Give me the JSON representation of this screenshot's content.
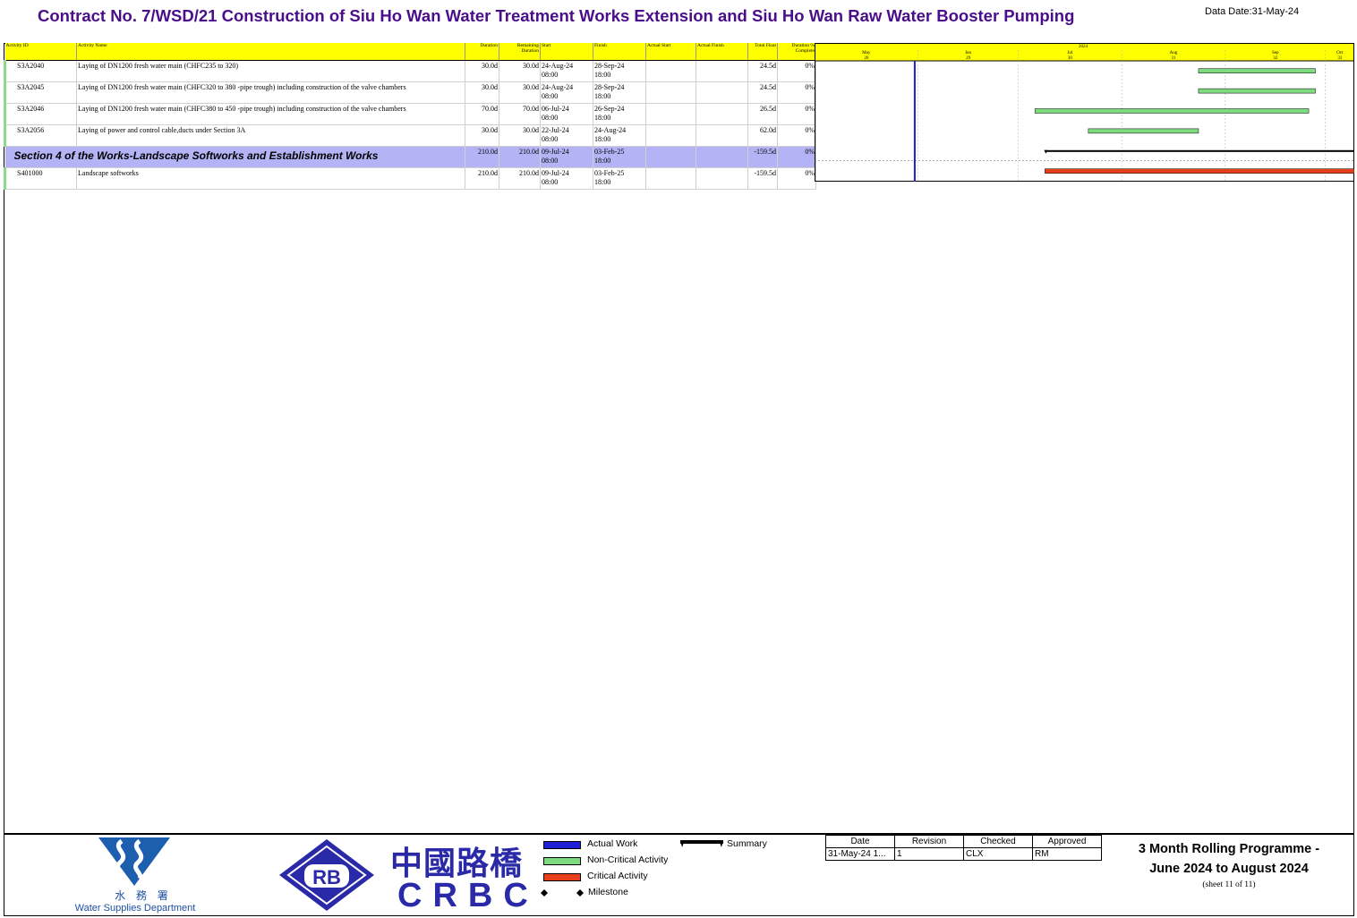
{
  "header": {
    "title": "Contract No. 7/WSD/21 Construction of Siu Ho Wan Water Treatment Works Extension and Siu Ho Wan Raw Water Booster Pumping",
    "data_date": "Data Date:31-May-24"
  },
  "columns": [
    "Activity ID",
    "Activity Name",
    "Duration",
    "Remaining Duration",
    "Start",
    "Finish",
    "Actual Start",
    "Actual Finish",
    "Total Float",
    "Duration % Complete"
  ],
  "rows": [
    {
      "type": "activity",
      "id": "S3A2040",
      "name": "Laying of DN1200 fresh water main (CHFC235 to 320)",
      "duration": "30.0d",
      "remaining": "30.0d",
      "start": "24-Aug-24",
      "start_time": "08:00",
      "finish": "28-Sep-24",
      "finish_time": "18:00",
      "actual_start": "",
      "actual_finish": "",
      "float": "24.5d",
      "complete": "0%"
    },
    {
      "type": "activity",
      "id": "S3A2045",
      "name": "Laying of DN1200 fresh water main (CHFC320 to 380 -pipe trough) including construction of the valve chambers",
      "duration": "30.0d",
      "remaining": "30.0d",
      "start": "24-Aug-24",
      "start_time": "08:00",
      "finish": "28-Sep-24",
      "finish_time": "18:00",
      "actual_start": "",
      "actual_finish": "",
      "float": "24.5d",
      "complete": "0%"
    },
    {
      "type": "activity",
      "id": "S3A2046",
      "name": "Laying of DN1200 fresh water main (CHFC380 to 450 -pipe trough) including construction of the valve chambers",
      "duration": "70.0d",
      "remaining": "70.0d",
      "start": "06-Jul-24",
      "start_time": "08:00",
      "finish": "26-Sep-24",
      "finish_time": "18:00",
      "actual_start": "",
      "actual_finish": "",
      "float": "26.5d",
      "complete": "0%"
    },
    {
      "type": "activity",
      "id": "S3A2056",
      "name": "Laying of power and control cable,ducts under Section 3A",
      "duration": "30.0d",
      "remaining": "30.0d",
      "start": "22-Jul-24",
      "start_time": "08:00",
      "finish": "24-Aug-24",
      "finish_time": "18:00",
      "actual_start": "",
      "actual_finish": "",
      "float": "62.0d",
      "complete": "0%"
    },
    {
      "type": "section",
      "name": "Section 4 of the Works-Landscape Softworks and Establishment Works",
      "duration": "210.0d",
      "remaining": "210.0d",
      "start": "09-Jul-24",
      "start_time": "08:00",
      "finish": "03-Feb-25",
      "finish_time": "18:00",
      "actual_start": "",
      "actual_finish": "",
      "float": "-159.5d",
      "complete": "0%"
    },
    {
      "type": "activity",
      "id": "S401000",
      "name": "Landscape softworks",
      "duration": "210.0d",
      "remaining": "210.0d",
      "start": "09-Jul-24",
      "start_time": "08:00",
      "finish": "03-Feb-25",
      "finish_time": "18:00",
      "actual_start": "",
      "actual_finish": "",
      "float": "-159.5d",
      "complete": "0%"
    }
  ],
  "timescale": {
    "year": "2024",
    "months": [
      "May",
      "Jun",
      "Jul",
      "Aug",
      "Sep",
      "Oct"
    ],
    "weeks": [
      "26",
      "29",
      "30",
      "31",
      "32",
      "33"
    ],
    "data_date": "2024-05-31"
  },
  "gantt_bars": [
    {
      "row": 0,
      "kind": "non-critical",
      "start": "2024-08-24",
      "finish": "2024-09-28"
    },
    {
      "row": 1,
      "kind": "non-critical",
      "start": "2024-08-24",
      "finish": "2024-09-28"
    },
    {
      "row": 2,
      "kind": "non-critical",
      "start": "2024-07-06",
      "finish": "2024-09-26"
    },
    {
      "row": 3,
      "kind": "non-critical",
      "start": "2024-07-22",
      "finish": "2024-08-24"
    },
    {
      "row": 4,
      "kind": "summary",
      "start": "2024-07-09",
      "finish": "2025-02-03"
    },
    {
      "row": 5,
      "kind": "critical",
      "start": "2024-07-09",
      "finish": "2025-02-03"
    }
  ],
  "colors": {
    "non_critical": "#7fdb7f",
    "critical": "#e8401c",
    "actual": "#1f1fd6",
    "summary": "#000000",
    "title": "#4b0e8a",
    "header_band": "#ffff00",
    "section_band": "#b3b3f5",
    "data_date_line": "#2020c0"
  },
  "logos": {
    "wsd_cn": "水 務 署",
    "wsd_en": "Water Supplies Department",
    "rb_text": "RB",
    "crbc_cn": "中國路橋",
    "crbc_en": "CRBC"
  },
  "legend": {
    "actual_work": "Actual Work",
    "non_critical": "Non-Critical Activity",
    "critical": "Critical Activity",
    "milestone": "Milestone",
    "summary": "Summary"
  },
  "approval": {
    "headers": [
      "Date",
      "Revision",
      "Checked",
      "Approved"
    ],
    "values": [
      "31-May-24 1...",
      "1",
      "CLX",
      "RM"
    ]
  },
  "programme": {
    "line1": "3 Month Rolling Programme -",
    "line2": "June 2024 to August 2024",
    "sheet": "(sheet 11 of 11)"
  }
}
